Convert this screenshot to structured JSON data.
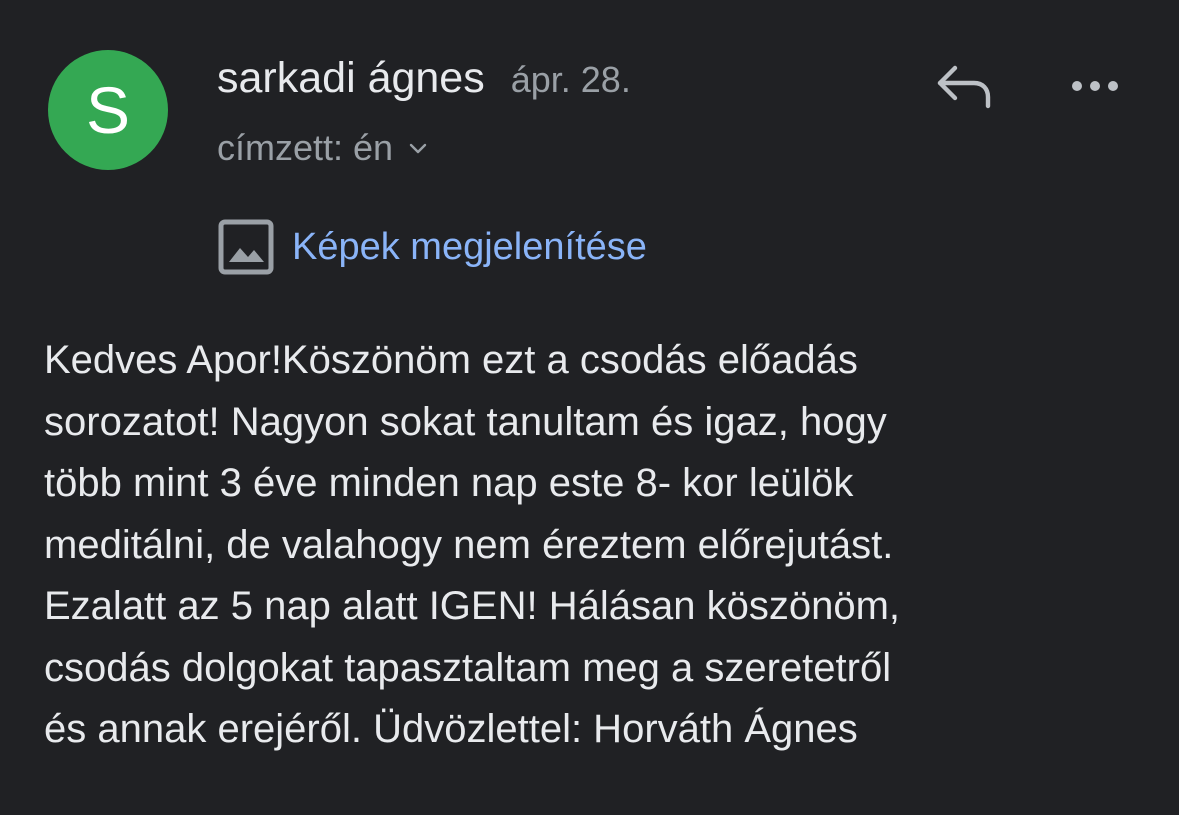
{
  "sender": {
    "initial": "S",
    "name": "sarkadi ágnes",
    "date": "ápr. 28."
  },
  "recipient": {
    "label": "címzett: én"
  },
  "actions": {
    "reply_icon": "reply-icon",
    "more_icon": "more-horizontal-icon"
  },
  "images": {
    "icon": "image-icon",
    "show_label": "Képek megjelenítése"
  },
  "message": {
    "body": "Kedves Apor!Köszönöm ezt a csodás előadás\nsorozatot! Nagyon sokat tanultam és igaz, hogy\ntöbb mint 3 éve minden nap este 8- kor leülök\nmeditálni, de valahogy nem éreztem előrejutást.\nEzalatt az 5 nap alatt IGEN! Hálásan köszönöm,\ncsodás dolgokat tapasztaltam meg a szeretetről\nés annak erejéről. Üdvözlettel: Horváth Ágnes"
  },
  "colors": {
    "background": "#202124",
    "avatar": "#34a853",
    "primary_text": "#e8eaed",
    "secondary_text": "#9aa0a6",
    "link": "#8ab4f8"
  }
}
